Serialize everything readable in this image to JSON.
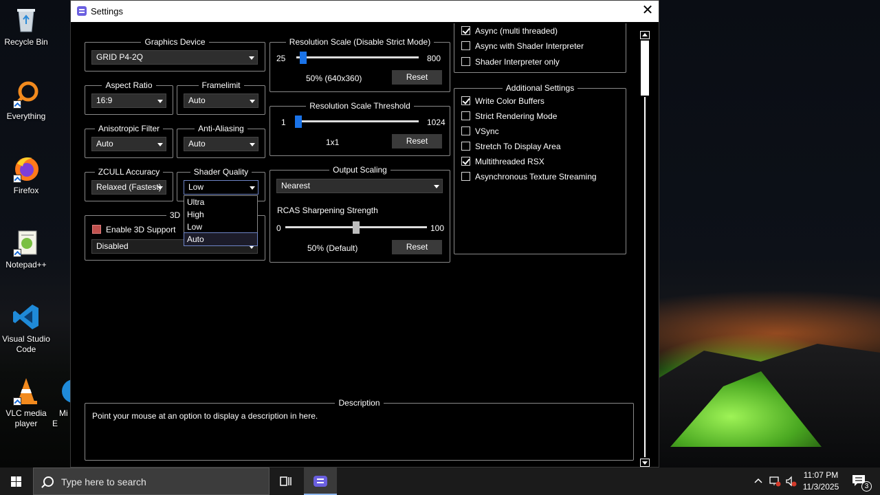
{
  "desktop": {
    "icons": [
      {
        "label": "Recycle Bin"
      },
      {
        "label": "Everything"
      },
      {
        "label": "Firefox"
      },
      {
        "label": "Notepad++"
      },
      {
        "label": "Visual Studio Code"
      },
      {
        "label": "VLC media player"
      },
      {
        "label": "Mi E"
      }
    ]
  },
  "window": {
    "title": "Settings",
    "close_glyph": "✕"
  },
  "graphics_device": {
    "title": "Graphics Device",
    "value": "GRID P4-2Q"
  },
  "aspect_ratio": {
    "title": "Aspect Ratio",
    "value": "16:9"
  },
  "framelimit": {
    "title": "Framelimit",
    "value": "Auto"
  },
  "anisotropic": {
    "title": "Anisotropic Filter",
    "value": "Auto"
  },
  "anti_aliasing": {
    "title": "Anti-Aliasing",
    "value": "Auto"
  },
  "zcull": {
    "title": "ZCULL Accuracy",
    "value": "Relaxed (Fastest)"
  },
  "shader_quality": {
    "title": "Shader Quality",
    "value": "Low",
    "options": [
      "Ultra",
      "High",
      "Low",
      "Auto"
    ],
    "highlighted": "Auto"
  },
  "three_d": {
    "title": "3D",
    "enable_label": "Enable 3D Support",
    "mode_value": "Disabled"
  },
  "resolution_scale": {
    "title": "Resolution Scale (Disable Strict Mode)",
    "min": "25",
    "max": "800",
    "value_label": "50% (640x360)",
    "reset": "Reset",
    "position": 0.03
  },
  "resolution_threshold": {
    "title": "Resolution Scale Threshold",
    "min": "1",
    "max": "1024",
    "value_label": "1x1",
    "reset": "Reset",
    "position": 0.0
  },
  "output_scaling": {
    "title": "Output Scaling",
    "value": "Nearest",
    "rcas_label": "RCAS Sharpening Strength",
    "min": "0",
    "max": "100",
    "value_label": "50% (Default)",
    "reset": "Reset",
    "position": 0.5
  },
  "shader_mode": {
    "items": [
      {
        "label": "Async (multi threaded)",
        "checked": true
      },
      {
        "label": "Async with Shader Interpreter",
        "checked": false
      },
      {
        "label": "Shader Interpreter only",
        "checked": false
      }
    ]
  },
  "additional": {
    "title": "Additional Settings",
    "items": [
      {
        "label": "Write Color Buffers",
        "checked": true
      },
      {
        "label": "Strict Rendering Mode",
        "checked": false
      },
      {
        "label": "VSync",
        "checked": false
      },
      {
        "label": "Stretch To Display Area",
        "checked": false
      },
      {
        "label": "Multithreaded RSX",
        "checked": true
      },
      {
        "label": "Asynchronous Texture Streaming",
        "checked": false
      }
    ]
  },
  "description": {
    "title": "Description",
    "text": "Point your mouse at an option to display a description in here."
  },
  "taskbar": {
    "search_placeholder": "Type here to search",
    "time": "11:07 PM",
    "date": "11/3/2025",
    "notification_count": "3"
  },
  "colors": {
    "slider_thumb": "#1a73e8",
    "slider_thumb_neutral": "#bdbdbd",
    "enable_3d_box": "#c0504d",
    "app_accent": "#6a5fe0"
  }
}
